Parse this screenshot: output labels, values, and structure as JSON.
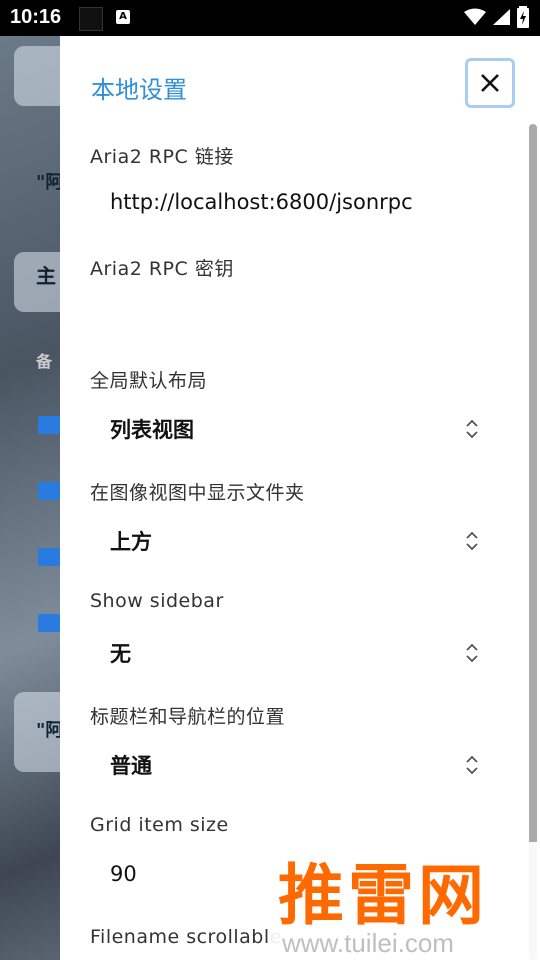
{
  "status_bar": {
    "time": "10:16",
    "notification_icon": "a-icon",
    "icons": [
      "wifi-icon",
      "signal-icon",
      "battery-icon"
    ]
  },
  "background_app": {
    "texts": [
      "\"阿",
      "主",
      "备",
      "\"阿"
    ]
  },
  "drawer": {
    "title": "本地设置",
    "close_icon": "close-icon",
    "fields": [
      {
        "label": "Aria2 RPC 链接",
        "value": "http://localhost:6800/jsonrpc",
        "type": "text"
      },
      {
        "label": "Aria2 RPC 密钥",
        "value": "",
        "type": "text"
      },
      {
        "label": "全局默认布局",
        "value": "列表视图",
        "type": "select"
      },
      {
        "label": "在图像视图中显示文件夹",
        "value": "上方",
        "type": "select"
      },
      {
        "label": "Show sidebar",
        "value": "无",
        "type": "select"
      },
      {
        "label": "标题栏和导航栏的位置",
        "value": "普通",
        "type": "select"
      },
      {
        "label": "Grid item size",
        "value": "90",
        "type": "number"
      },
      {
        "label": "Filename scrollable",
        "value": "",
        "type": "select"
      }
    ]
  },
  "watermark": {
    "main": "推雷网",
    "url": "www.tuilei.com"
  },
  "colors": {
    "accent": "#2f8fd8",
    "watermark": "#ff6a00"
  }
}
